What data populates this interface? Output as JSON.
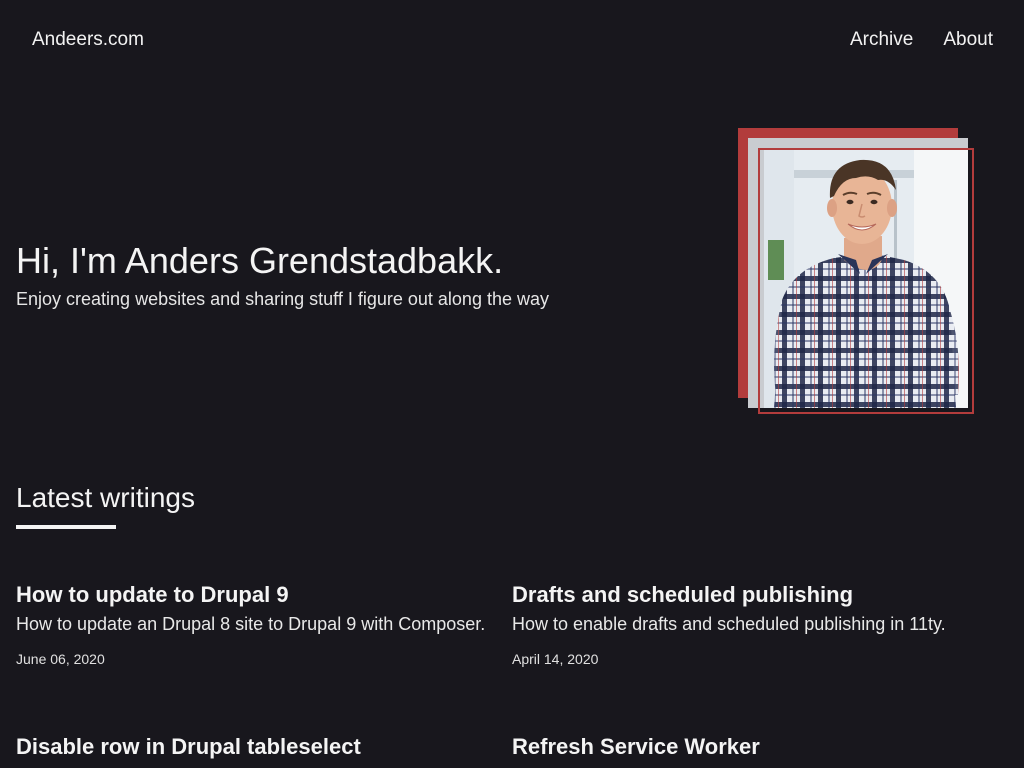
{
  "header": {
    "logo": "Andeers.com",
    "nav": [
      {
        "label": "Archive"
      },
      {
        "label": "About"
      }
    ]
  },
  "hero": {
    "title": "Hi, I'm Anders Grendstadbakk.",
    "subtitle": "Enjoy creating websites and sharing stuff I figure out along the way"
  },
  "latest": {
    "title": "Latest writings",
    "posts": [
      {
        "title": "How to update to Drupal 9",
        "description": "How to update an Drupal 8 site to Drupal 9 with Composer.",
        "date": "June 06, 2020"
      },
      {
        "title": "Drafts and scheduled publishing",
        "description": "How to enable drafts and scheduled publishing in 11ty.",
        "date": "April 14, 2020"
      },
      {
        "title": "Disable row in Drupal tableselect",
        "description": "",
        "date": ""
      },
      {
        "title": "Refresh Service Worker",
        "description": "",
        "date": ""
      }
    ]
  },
  "colors": {
    "background": "#18171d",
    "accent": "#b23c3c",
    "text": "#f4f4f4"
  }
}
